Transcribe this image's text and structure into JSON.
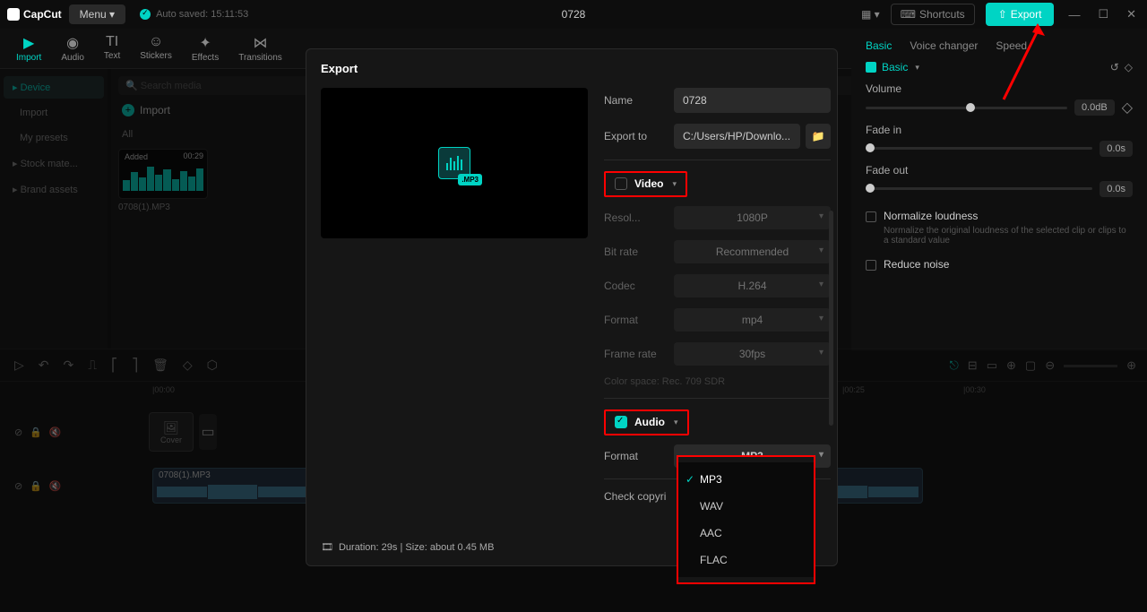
{
  "titlebar": {
    "app_name": "CapCut",
    "menu_label": "Menu",
    "autosaved": "Auto saved: 15:11:53",
    "project_title": "0728",
    "shortcuts_label": "Shortcuts",
    "export_label": "Export"
  },
  "toolbar": {
    "items": [
      {
        "label": "Import",
        "active": true
      },
      {
        "label": "Audio"
      },
      {
        "label": "Text"
      },
      {
        "label": "Stickers"
      },
      {
        "label": "Effects"
      },
      {
        "label": "Transitions"
      }
    ]
  },
  "left_panel": {
    "items": [
      "Device",
      "Import",
      "My presets",
      "Stock mate...",
      "Brand assets"
    ],
    "active": "Device"
  },
  "media": {
    "search_placeholder": "Search media",
    "import_label": "Import",
    "all_label": "All",
    "clip_added": "Added",
    "clip_duration": "00:29",
    "clip_name": "0708(1).MP3"
  },
  "right_panel": {
    "tabs": [
      "Basic",
      "Voice changer",
      "Speed"
    ],
    "active_tab": "Basic",
    "basic_label": "Basic",
    "volume_label": "Volume",
    "volume_value": "0.0dB",
    "fadein_label": "Fade in",
    "fadein_value": "0.0s",
    "fadeout_label": "Fade out",
    "fadeout_value": "0.0s",
    "normalize_label": "Normalize loudness",
    "normalize_desc": "Normalize the original loudness of the selected clip or clips to a standard value",
    "reduce_label": "Reduce noise"
  },
  "timeline": {
    "ticks": [
      "|00:00",
      "|00:25",
      "|00:30"
    ],
    "cover_label": "Cover",
    "clip_name": "0708(1).MP3"
  },
  "export_dialog": {
    "title": "Export",
    "name_label": "Name",
    "name_value": "0728",
    "exportto_label": "Export to",
    "exportto_value": "C:/Users/HP/Downlo...",
    "video_label": "Video",
    "video_checked": false,
    "video_fields": {
      "resolution_label": "Resol...",
      "resolution_value": "1080P",
      "bitrate_label": "Bit rate",
      "bitrate_value": "Recommended",
      "codec_label": "Codec",
      "codec_value": "H.264",
      "format_label": "Format",
      "format_value": "mp4",
      "framerate_label": "Frame rate",
      "framerate_value": "30fps",
      "colorspace": "Color space: Rec. 709 SDR"
    },
    "audio_label": "Audio",
    "audio_checked": true,
    "audio_format_label": "Format",
    "audio_format_value": "MP3",
    "audio_format_options": [
      "MP3",
      "WAV",
      "AAC",
      "FLAC"
    ],
    "check_copyright": "Check copyri",
    "duration_info": "Duration: 29s | Size: about 0.45 MB",
    "mp3_badge": ".MP3"
  }
}
